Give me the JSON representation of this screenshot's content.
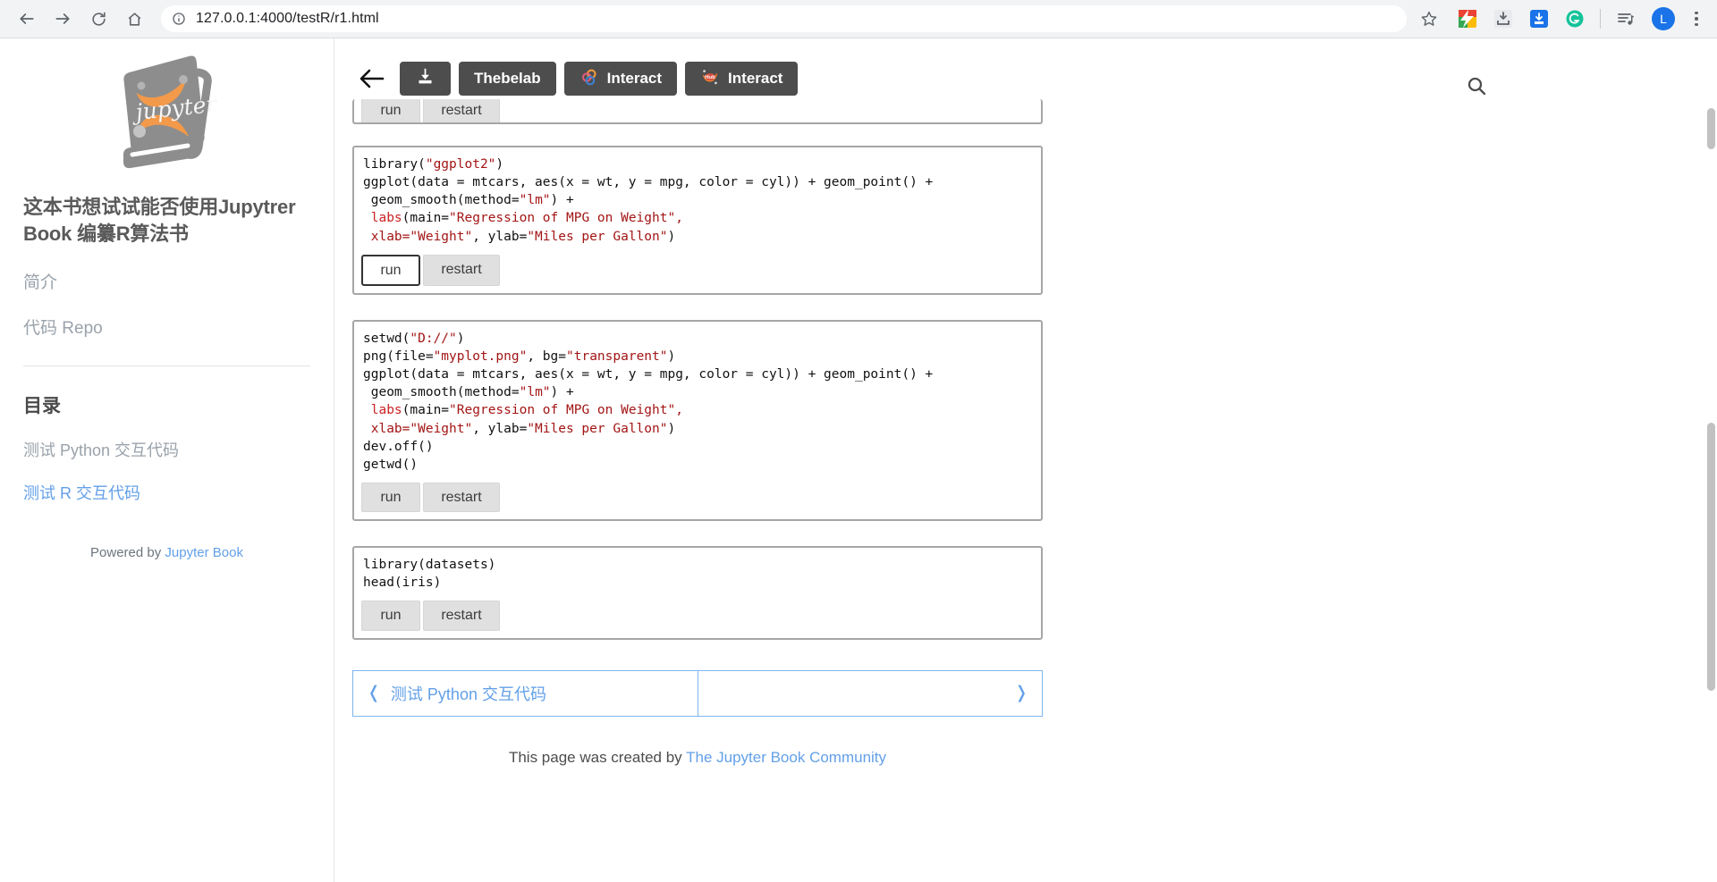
{
  "browser": {
    "url": "127.0.0.1:4000/testR/r1.html",
    "back_icon": "back-arrow-icon",
    "forward_icon": "forward-arrow-icon",
    "reload_icon": "reload-icon",
    "home_icon": "home-icon",
    "info_icon": "page-info-icon",
    "star_icon": "bookmark-star-icon",
    "avatar_label": "L",
    "extensions": [
      {
        "name": "colorful-extension-icon",
        "color": "#4285f4"
      },
      {
        "name": "download-extension-icon",
        "color": "#9aa0a6"
      },
      {
        "name": "save-page-extension-icon",
        "color": "#1a73e8"
      },
      {
        "name": "grammarly-extension-icon",
        "color": "#15c39a"
      },
      {
        "name": "playlist-extension-icon",
        "color": "#5f6368"
      }
    ]
  },
  "sidebar": {
    "logo_name": "jupyter-book-logo",
    "logo_text": "jupyter",
    "site_title": "这本书想试试能否使用Jupytrer Book 编纂R算法书",
    "links": [
      {
        "label": "简介",
        "name": "sidebar-link-intro"
      },
      {
        "label": "代码 Repo",
        "name": "sidebar-link-repo"
      }
    ],
    "toc_heading": "目录",
    "toc_items": [
      {
        "label": "测试 Python 交互代码",
        "active": false
      },
      {
        "label": "测试 R 交互代码",
        "active": true
      }
    ],
    "powered_prefix": "Powered by ",
    "powered_link": "Jupyter Book"
  },
  "toolbar": {
    "back_label": "←",
    "download_label": "download-icon",
    "thebelab_label": "Thebelab",
    "binder_interact_label": "Interact",
    "hub_interact_label": "Interact",
    "search_label": "search-icon"
  },
  "cells": [
    {
      "id": "cell-clipped",
      "code_lines": [],
      "run_label": "run",
      "restart_label": "restart",
      "clipped": true
    },
    {
      "id": "cell-ggplot",
      "code": "library(\"ggplot2\")\nggplot(data = mtcars, aes(x = wt, y = mpg, color = cyl)) + geom_point() +\n geom_smooth(method=\"lm\") +\n labs(main=\"Regression of MPG on Weight\",\n xlab=\"Weight\", ylab=\"Miles per Gallon\")",
      "run_label": "run",
      "restart_label": "restart",
      "run_focused": true
    },
    {
      "id": "cell-png-export",
      "code": "setwd(\"D://\")\npng(file=\"myplot.png\", bg=\"transparent\")\nggplot(data = mtcars, aes(x = wt, y = mpg, color = cyl)) + geom_point() +\n geom_smooth(method=\"lm\") +\n labs(main=\"Regression of MPG on Weight\",\n xlab=\"Weight\", ylab=\"Miles per Gallon\")\ndev.off()\ngetwd()",
      "run_label": "run",
      "restart_label": "restart",
      "run_focused": false
    },
    {
      "id": "cell-iris",
      "code": "library(datasets)\nhead(iris)",
      "run_label": "run",
      "restart_label": "restart",
      "run_focused": false
    }
  ],
  "pager": {
    "prev_chevron": "❬",
    "prev_label": "测试 Python 交互代码",
    "next_label": "",
    "next_chevron": "❭"
  },
  "footer": {
    "prefix": "This page was created by ",
    "link": "The Jupyter Book Community"
  },
  "colors": {
    "accent_blue": "#63a0e8",
    "toolbar_dark": "#4d4d4d",
    "code_string": "#a31515",
    "logo_orange": "#f08d3c",
    "logo_gray": "#9a9a9a"
  }
}
